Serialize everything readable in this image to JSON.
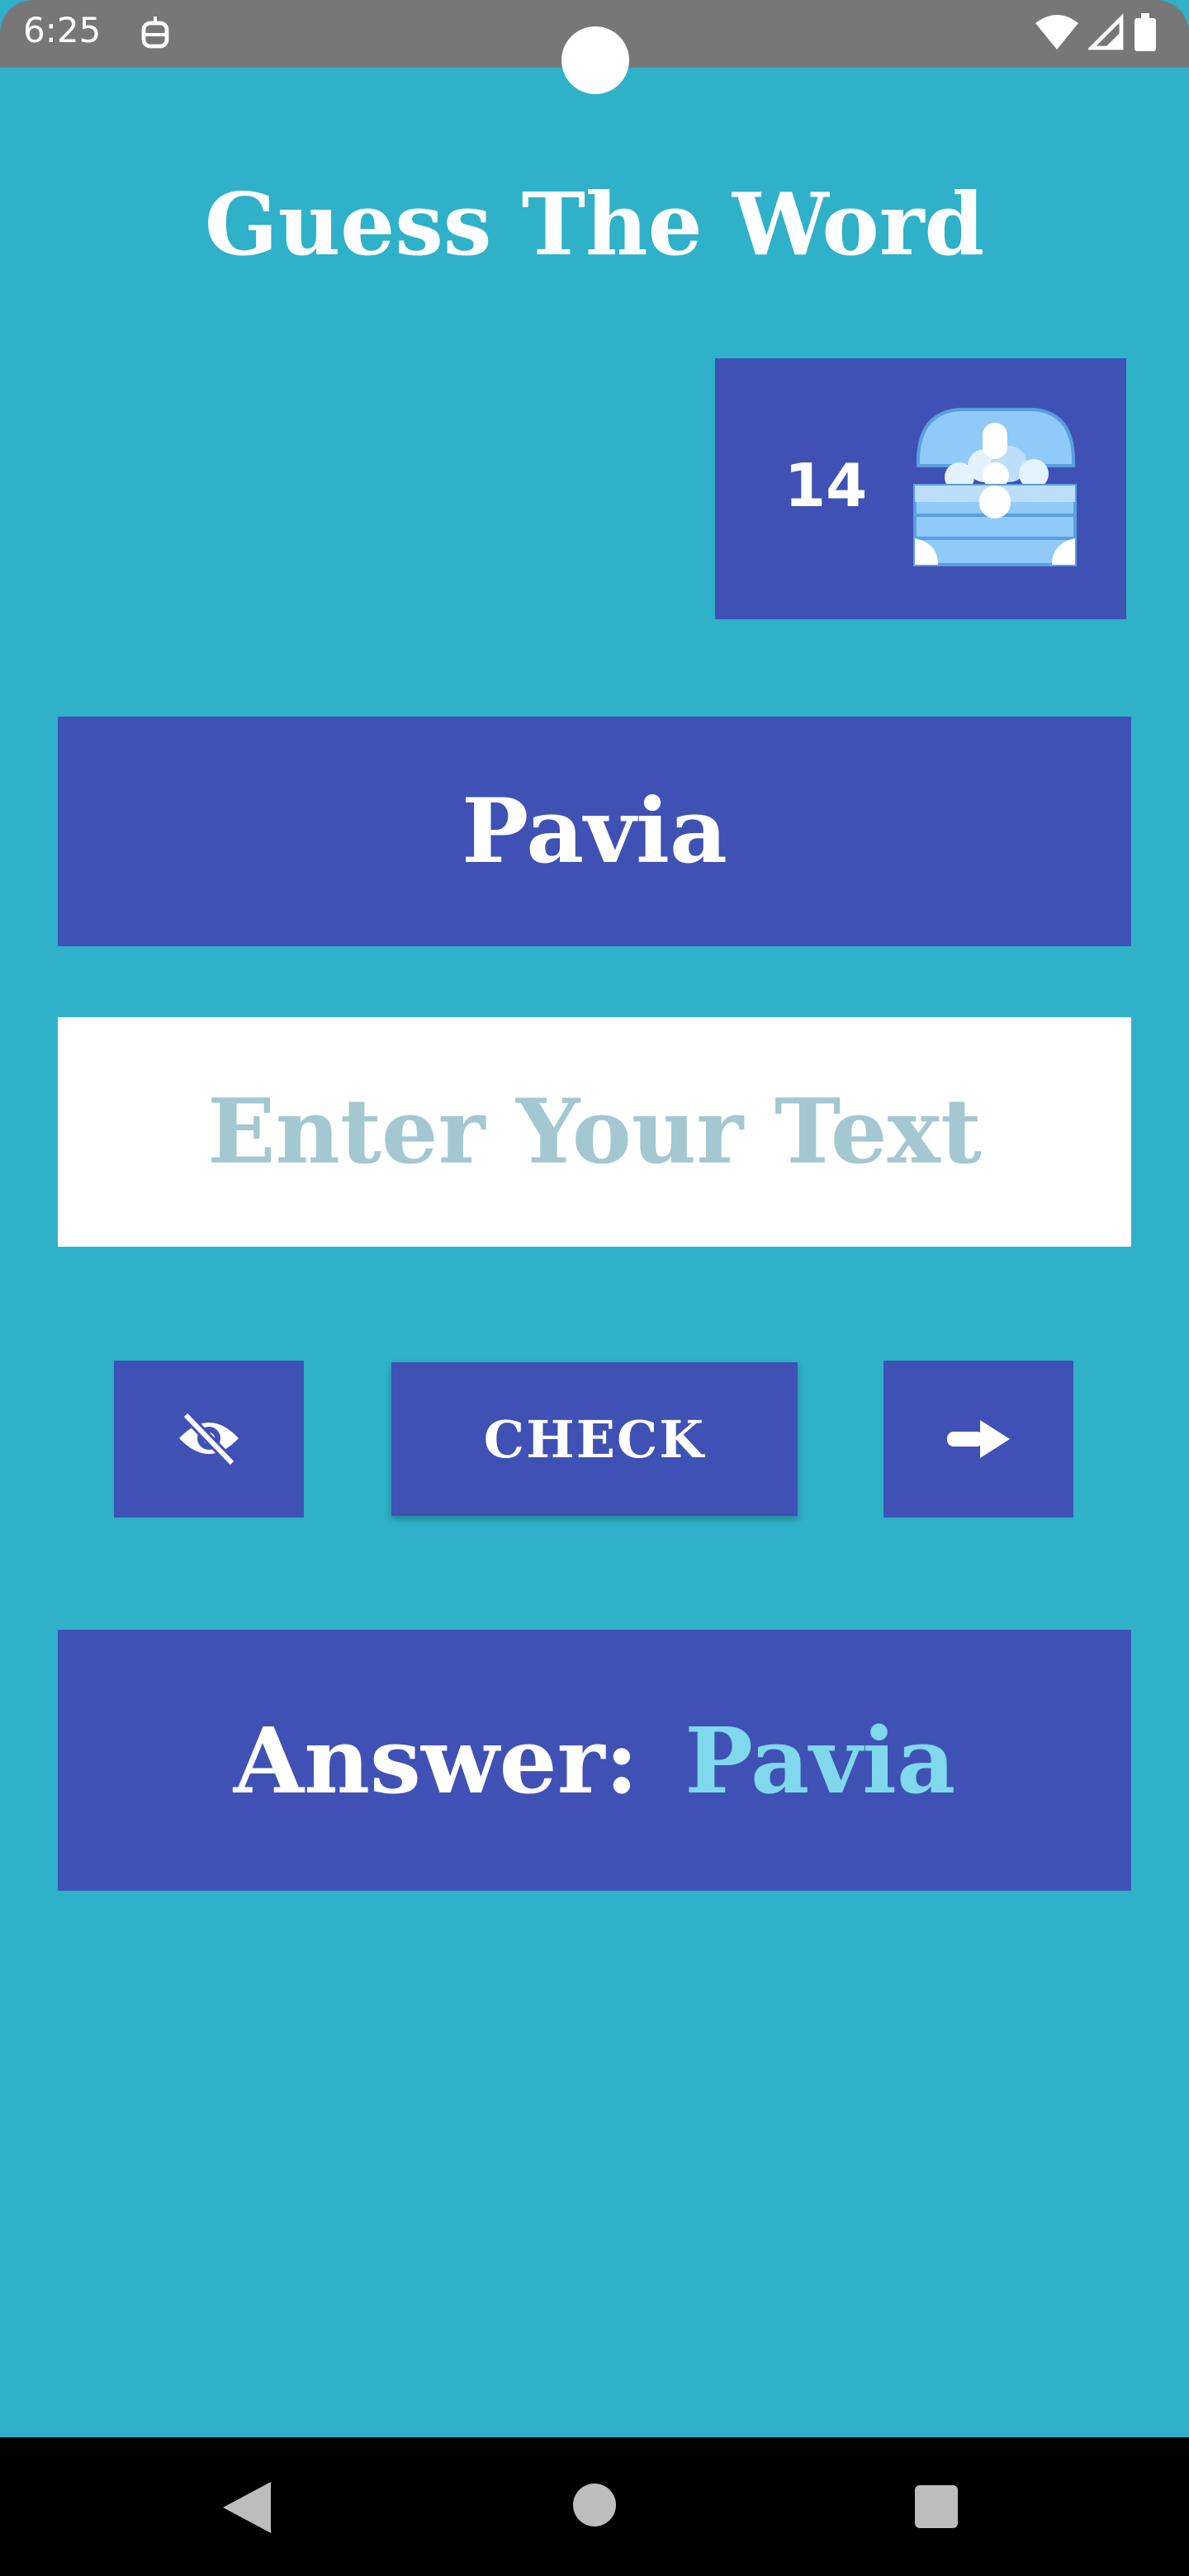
{
  "status_bar": {
    "time": "6:25",
    "notification_icon": "robot-notification-icon",
    "icons": [
      "wifi-icon",
      "cell-signal-icon",
      "battery-icon"
    ]
  },
  "app": {
    "title": "Guess The Word"
  },
  "coins": {
    "count": "14",
    "icon": "treasure-chest-icon"
  },
  "word": {
    "text": "Pavia"
  },
  "input": {
    "value": "",
    "placeholder": "Enter Your Text"
  },
  "actions": {
    "hide_icon": "eye-off-icon",
    "check_label": "CHECK",
    "next_icon": "arrow-right-icon"
  },
  "answer": {
    "label": "Answer:",
    "value": "Pavia"
  },
  "nav": {
    "icons": [
      "back-icon",
      "home-icon",
      "recents-icon"
    ]
  },
  "colors": {
    "background": "#2fb1c9",
    "panel": "#3f51b5",
    "answer_value": "#7fd8ec",
    "placeholder": "#a3c8d1",
    "status_bar": "#777777"
  }
}
